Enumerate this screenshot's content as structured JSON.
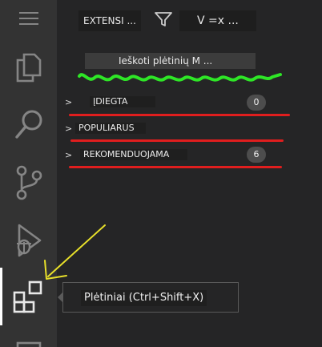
{
  "header": {
    "title": "EXTENSI ...",
    "views_label": "V =x ..."
  },
  "search": {
    "placeholder": "Ieškoti plėtinių M ..."
  },
  "sections": [
    {
      "label": "ĮDIEGTA",
      "count": "0",
      "chevron": ">"
    },
    {
      "label": "POPULIARUS",
      "chevron": ">"
    },
    {
      "label": "REKOMENDUOJAMA",
      "count": "6",
      "chevron": ">"
    }
  ],
  "tooltip": {
    "text": "Plėtiniai (Ctrl+Shift+X)"
  },
  "activity_bar": {
    "items": [
      "menu-icon",
      "explorer-icon",
      "search-icon",
      "source-control-icon",
      "run-debug-icon",
      "extensions-icon",
      "more-icon"
    ]
  },
  "annotations": {
    "underline_color": "#e01e1e",
    "squiggle_color": "#2ee626",
    "arrow_color": "#e8e02a"
  }
}
